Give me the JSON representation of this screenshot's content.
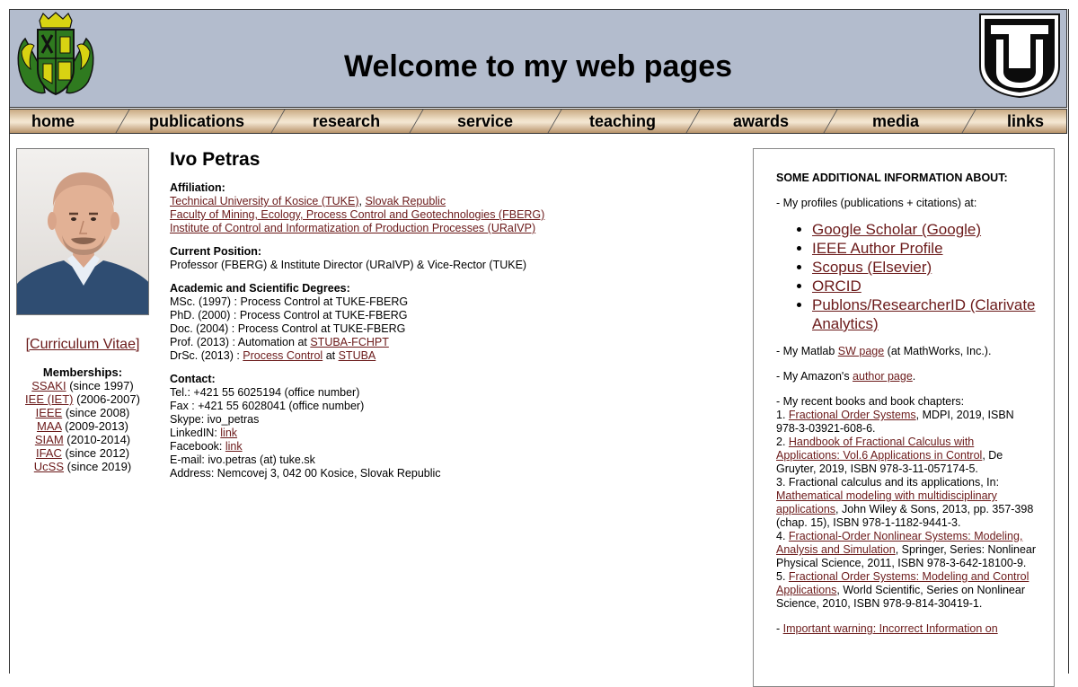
{
  "header": {
    "title": "Welcome to my web pages"
  },
  "nav": [
    {
      "label": "home"
    },
    {
      "label": "publications"
    },
    {
      "label": "research"
    },
    {
      "label": "service"
    },
    {
      "label": "teaching"
    },
    {
      "label": "awards"
    },
    {
      "label": "media"
    },
    {
      "label": "links"
    }
  ],
  "sidebar": {
    "cv_label": "[Curriculum Vitae]",
    "memberships_title": "Memberships:",
    "memberships": [
      {
        "org": "SSAKI",
        "years": "(since 1997)"
      },
      {
        "org": "IEE (IET)",
        "years": "(2006-2007)"
      },
      {
        "org": "IEEE",
        "years": "(since 2008)"
      },
      {
        "org": "MAA",
        "years": "(2009-2013)"
      },
      {
        "org": "SIAM",
        "years": "(2010-2014)"
      },
      {
        "org": "IFAC",
        "years": "(since 2012)"
      },
      {
        "org": "UcSS",
        "years": "(since 2019)"
      }
    ]
  },
  "main": {
    "name": "Ivo Petras",
    "affiliation_label": "Affiliation:",
    "affiliation_tuke": "Technical University of Kosice (TUKE)",
    "affiliation_comma": ",",
    "affiliation_country": "Slovak Republic",
    "affiliation_faculty": "Faculty of Mining, Ecology, Process Control and Geotechnologies (FBERG)",
    "affiliation_institute": "Institute of Control and Informatization of Production Processes (URaIVP)",
    "position_label": "Current Position:",
    "position_text": "Professor (FBERG) & Institute Director (URaIVP) & Vice-Rector (TUKE)",
    "degrees_label": "Academic and Scientific Degrees:",
    "deg_msc": "MSc. (1997) : Process Control at TUKE-FBERG",
    "deg_phd": "PhD. (2000) : Process Control at TUKE-FBERG",
    "deg_doc": "Doc. (2004) : Process Control at TUKE-FBERG",
    "deg_prof_pre": "Prof. (2013) : Automation at ",
    "deg_prof_link": "STUBA-FCHPT",
    "deg_drsc_pre": "DrSc. (2013) : ",
    "deg_drsc_link1": "Process Control",
    "deg_drsc_mid": " at ",
    "deg_drsc_link2": "STUBA",
    "contact_label": "Contact:",
    "tel": "Tel.: +421 55 6025194 (office number)",
    "fax": "Fax : +421 55 6028041 (office number)",
    "skype": "Skype: ivo_petras",
    "linkedin_pre": "LinkedIN: ",
    "linkedin_link": "link",
    "facebook_pre": "Facebook: ",
    "facebook_link": "link",
    "email": "E-mail: ivo.petras (at) tuke.sk",
    "address": "Address: Nemcovej 3, 042 00 Kosice, Slovak Republic"
  },
  "right": {
    "heading": "SOME ADDITIONAL INFORMATION ABOUT:",
    "profiles_intro": "- My profiles (publications + citations) at:",
    "profiles": [
      "Google Scholar (Google)",
      "IEEE Author Profile",
      "Scopus (Elsevier)",
      "ORCID",
      "Publons/ResearcherID (Clarivate Analytics)"
    ],
    "matlab_pre": "- My Matlab ",
    "matlab_link": "SW page",
    "matlab_post": " (at MathWorks, Inc.).",
    "amazon_pre": "- My Amazon's ",
    "amazon_link": "author page",
    "amazon_post": ".",
    "books_intro": "- My recent books and book chapters:",
    "b1_num": "1. ",
    "b1_link": "Fractional Order Systems",
    "b1_text": ", MDPI, 2019, ISBN 978-3-03921-608-6.",
    "b2_num": "2. ",
    "b2_link": "Handbook of Fractional Calculus with Applications: Vol.6 Applications in Control",
    "b2_text": ", De Gruyter, 2019, ISBN 978-3-11-057174-5.",
    "b3_text1": "3. Fractional calculus and its applications, In: ",
    "b3_link": "Mathematical modeling with multidisciplinary applications",
    "b3_text2": ", John Wiley & Sons, 2013, pp. 357-398 (chap. 15), ISBN 978-1-1182-9441-3.",
    "b4_num": "4. ",
    "b4_link": "Fractional-Order Nonlinear Systems: Modeling, Analysis and Simulation",
    "b4_text": ", Springer, Series: Nonlinear Physical Science, 2011, ISBN 978-3-642-18100-9.",
    "b5_num": "5. ",
    "b5_link": "Fractional Order Systems: Modeling and Control Applications",
    "b5_text": ", World Scientific, Series on Nonlinear Science, 2010, ISBN 978-9-814-30419-1.",
    "warning_pre": "- ",
    "warning_link": "Important warning: Incorrect Information on"
  }
}
